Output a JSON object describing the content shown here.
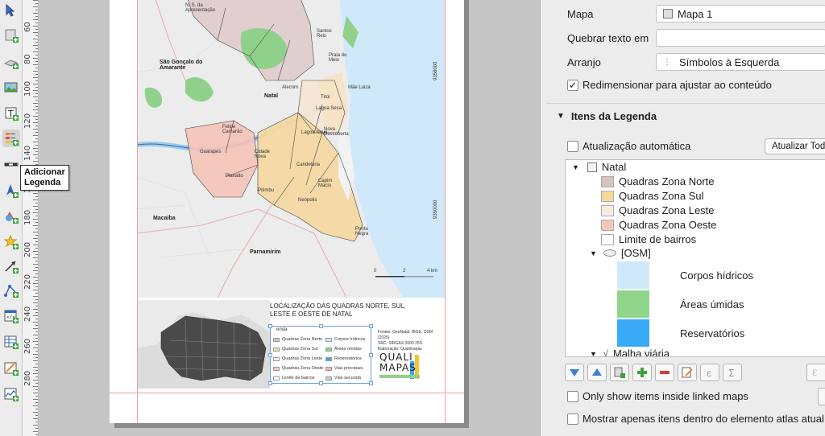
{
  "toolbar": {
    "tooltip": "Adicionar\nLegenda",
    "buttons": [
      "select-move-item-icon",
      "add-image-icon",
      "add-3d-map-icon",
      "add-picture-icon",
      "add-label-icon",
      "add-legend-icon",
      "add-scalebar-icon",
      "add-north-arrow-icon",
      "add-shape-icon",
      "add-marker-icon",
      "add-arrow-icon",
      "add-node-item-icon",
      "add-html-icon",
      "add-attribute-table-icon",
      "add-fixed-table-icon",
      "add-elevation-profile-icon"
    ]
  },
  "ruler": {
    "labels": [
      "60",
      "80",
      "100",
      "120",
      "140",
      "160",
      "180",
      "200",
      "220",
      "240",
      "260",
      "280"
    ]
  },
  "map": {
    "labels": {
      "sao_goncalo": "São Gonçalo do\nAmarante",
      "natal": "Natal",
      "macaiba": "Macaíba",
      "parnamirim": "Parnamirim",
      "ns_apresentacao": "N. S. da\nApresentação",
      "santos_reis": "Santos\nReis",
      "praia_meio": "Praia do\nMeio",
      "alecrim": "Alecrim",
      "tirol": "Tirol",
      "lagoa_seca": "Lagoa Seca",
      "lagoa_nova": "Lagoa Nova",
      "nova_descoberta": "Nova\nDescoberta",
      "candelaria": "Candelária",
      "pitimbu": "Pitimbu",
      "capim_macio": "Capim\nMacio",
      "neopolis": "Neópolis",
      "ponta_negra": "Ponta\nNegra",
      "guarapes": "Guarapes",
      "planalto": "Planalto",
      "cidade_nova": "Cidade\nNova",
      "felipe_camarao": "Felipe\nCamarão",
      "mae_luiza": "Mãe Luiza",
      "coord_top": "9358000",
      "coord_bottom": "9350000",
      "scale_0": "0",
      "scale_2": "2",
      "scale_4": "4 km"
    }
  },
  "layout_legend": {
    "title": "LOCALIZAÇÃO DAS QUADRAS NORTE, SUL, LESTE E OESTE DE NATAL",
    "heading": "enda",
    "items_left": [
      {
        "label": "Quadras Zona Norte",
        "color": "#d9c2c2"
      },
      {
        "label": "Quadras Zona Sul",
        "color": "#f6d9a3"
      },
      {
        "label": "Quadras Zona Leste",
        "color": "#f8ece0"
      },
      {
        "label": "Quadras Zona Oeste",
        "color": "#f6c4b8"
      },
      {
        "label": "Limite de bairros",
        "color": "#ffffff"
      }
    ],
    "items_right": [
      {
        "label": "Corpos hídricos",
        "color": "#cfe9fb"
      },
      {
        "label": "Áreas úmidas",
        "color": "#8fd08a"
      },
      {
        "label": "Reservatórios",
        "color": "#3aa7f3"
      },
      {
        "label": "Vias principais",
        "color": "#f4b3b3"
      },
      {
        "label": "Vias secundá",
        "color": "#cccccc"
      }
    ],
    "fontes": "Fontes: GeoNatal, IBGE, OSM\n(2025)\nSRC: SIRGAS 2000 25S\nElaboração: Qualimapas",
    "logo": "QUALI\nMAPAS"
  },
  "panel": {
    "mapa_label": "Mapa",
    "mapa_value": "Mapa 1",
    "quebrar_label": "Quebrar texto em",
    "quebrar_value": "",
    "arranjo_label": "Arranjo",
    "arranjo_value": "Símbolos à Esquerda",
    "redimensionar_label": "Redimensionar para ajustar ao conteúdo",
    "redimensionar_checked": "✓",
    "section_title": "Itens da Legenda",
    "auto_update_label": "Atualização automática",
    "update_all_button": "Atualizar Todos",
    "tree": {
      "group": "Natal",
      "items": [
        {
          "label": "Quadras Zona Norte",
          "color": "#d7c3c3"
        },
        {
          "label": "Quadras Zona Sul",
          "color": "#f8d79a"
        },
        {
          "label": "Quadras Zona Leste",
          "color": "#faeadf"
        },
        {
          "label": "Quadras Zona Oeste",
          "color": "#f7c6bb"
        },
        {
          "label": "Limite de bairros",
          "color": "#ffffff"
        }
      ],
      "osm_group": "[OSM]",
      "osm_items": [
        {
          "label": "Corpos hídricos",
          "color": "#cfe9fb"
        },
        {
          "label": "Áreas úmidas",
          "color": "#8fd58a"
        },
        {
          "label": "Reservatórios",
          "color": "#39aaf5"
        }
      ],
      "malha": "Malha viária"
    },
    "linked_only_label": "Only show items inside linked maps",
    "atlas_only_label": "Mostrar apenas itens dentro do elemento atlas atual"
  },
  "colors": {
    "accent": "#3a7fd4",
    "guide": "#f2a0a0",
    "sea": "#cfe9fb"
  }
}
